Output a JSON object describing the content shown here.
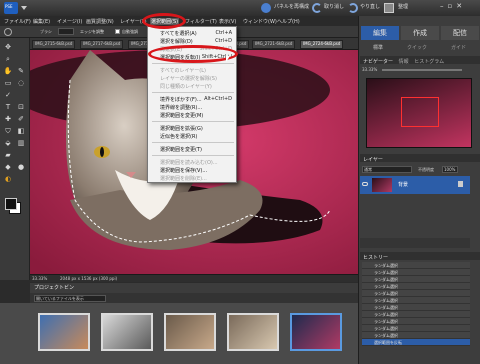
{
  "menubar": {
    "items": [
      "ファイル(F)",
      "編集(E)",
      "イメージ(I)",
      "画質調整(N)",
      "レイヤー(L)",
      "選択範囲(S)",
      "フィルター(T)",
      "表示(V)",
      "ウィンドウ(W)",
      "ヘルプ(H)"
    ]
  },
  "titlebar": {
    "logo_text": "PSE",
    "fix_label": "パネルを再構成",
    "undo_label": "取り消し",
    "redo_label": "やり直し",
    "organizer_label": "整理",
    "create_label": "作成"
  },
  "optbar": {
    "mode_label": "範囲",
    "brush_label": "ブラシ",
    "refine_label": "エッジを調整",
    "auto_enhance_label": "自動強調"
  },
  "doc_tabs": [
    "IMG_2715-6kB.psd",
    "IMG_2717-6kB.psd",
    "IMG_2719-6kB.psd",
    "IMG_2720-6kB.psd",
    "IMG_2721-6kB.psd",
    "IMG_2724-6kB.psd"
  ],
  "status": {
    "zoom": "33.33%",
    "doc_info": "2048 px x 1536 px (300 ppi)"
  },
  "bin": {
    "header": "プロジェクトビン",
    "dropdown": "開いているファイルを表示"
  },
  "right": {
    "mode_tabs": [
      "編集",
      "作成",
      "配信"
    ],
    "edit_subtabs": [
      "標準",
      "クイック",
      "ガイド"
    ],
    "navigator_tabs": [
      "ナビゲーター",
      "情報",
      "ヒストグラム"
    ],
    "zoom": "33.33%",
    "layers_title": "レイヤー",
    "blend_mode": "通常",
    "opacity_label": "不透明度",
    "opacity_value": "100%",
    "layer_name": "背景",
    "history_title": "ヒストリー",
    "history_items": [
      "ランダム選択",
      "ランダム選択",
      "ランダム選択",
      "ランダム選択",
      "ランダム選択",
      "ランダム選択",
      "ランダム選択",
      "ランダム選択",
      "ランダム選択",
      "ランダム選択",
      "ランダム選択"
    ],
    "history_last": "選択範囲を反転"
  },
  "dropdown": {
    "items": [
      {
        "label": "すべてを選択(A)",
        "shortcut": "Ctrl+A",
        "disabled": false
      },
      {
        "label": "選択を解除(D)",
        "shortcut": "Ctrl+D",
        "disabled": false
      },
      {
        "label": "再選択(E)",
        "shortcut": "Shift+Ctrl+D",
        "disabled": true
      },
      {
        "label": "選択範囲を反転(I)",
        "shortcut": "Shift+Ctrl+I",
        "disabled": false
      },
      {
        "label": "すべてのレイヤー(L)",
        "shortcut": "",
        "disabled": true
      },
      {
        "label": "レイヤーの選択を解除(S)",
        "shortcut": "",
        "disabled": true
      },
      {
        "label": "同じ種類のレイヤー(Y)",
        "shortcut": "",
        "disabled": true
      },
      {
        "label": "境界をぼかす(F)...",
        "shortcut": "Alt+Ctrl+D",
        "disabled": false
      },
      {
        "label": "境界線を調整(R)...",
        "shortcut": "",
        "disabled": false
      },
      {
        "label": "選択範囲を変更(M)",
        "shortcut": "",
        "disabled": false
      },
      {
        "label": "選択範囲を拡張(G)",
        "shortcut": "",
        "disabled": false
      },
      {
        "label": "近似色を選択(R)",
        "shortcut": "",
        "disabled": false
      },
      {
        "label": "選択範囲を変更(T)",
        "shortcut": "",
        "disabled": false
      },
      {
        "label": "選択範囲を読み込む(O)...",
        "shortcut": "",
        "disabled": true
      },
      {
        "label": "選択範囲を保存(V)...",
        "shortcut": "",
        "disabled": false
      },
      {
        "label": "選択範囲を削除(E)...",
        "shortcut": "",
        "disabled": true
      }
    ]
  },
  "colors": {
    "accent_highlight": "#d8161a",
    "canvas_bg": "#b0234f",
    "panel_bg": "#3d3d3d"
  }
}
